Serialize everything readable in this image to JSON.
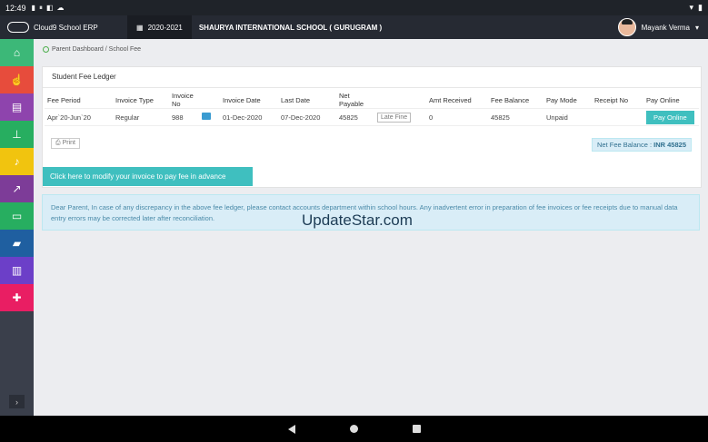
{
  "status_bar": {
    "time": "12:49",
    "left_icons": [
      "notification-icon",
      "pause-icon",
      "flipboard-icon",
      "cloud-icon"
    ],
    "right_icons": [
      "wifi-icon",
      "battery-icon"
    ]
  },
  "header": {
    "app_name": "Cloud9 School ERP",
    "academic_year": "2020-2021",
    "school_name": "SHAURYA INTERNATIONAL SCHOOL ( GURUGRAM )",
    "user_name": "Mayank Verma"
  },
  "sidebar": {
    "items": [
      {
        "icon": "home-icon",
        "color": "#3cb878"
      },
      {
        "icon": "hand-pointer-icon",
        "color": "#e74c3c"
      },
      {
        "icon": "file-icon",
        "color": "#8e44ad"
      },
      {
        "icon": "pin-icon",
        "color": "#27ae60"
      },
      {
        "icon": "bell-icon",
        "color": "#f1c40f"
      },
      {
        "icon": "chart-line-icon",
        "color": "#7d3c98"
      },
      {
        "icon": "credit-card-icon",
        "color": "#27ae60"
      },
      {
        "icon": "book-icon",
        "color": "#1f5fa0"
      },
      {
        "icon": "building-icon",
        "color": "#6c3fc8"
      },
      {
        "icon": "plus-icon",
        "color": "#e91e63"
      }
    ],
    "toggle": "›"
  },
  "breadcrumb": "Parent Dashboard / School Fee",
  "ledger": {
    "title": "Student Fee Ledger",
    "columns": [
      "Fee Period",
      "Invoice Type",
      "Invoice No",
      "",
      "Invoice Date",
      "Last Date",
      "Net Payable",
      "",
      "Amt Received",
      "Fee Balance",
      "Pay Mode",
      "Receipt No",
      "Pay Online"
    ],
    "rows": [
      {
        "fee_period": "Apr`20-Jun`20",
        "invoice_type": "Regular",
        "invoice_no": "988",
        "invoice_date": "01-Dec-2020",
        "last_date": "07-Dec-2020",
        "net_payable": "45825",
        "late_fine": "Late Fine",
        "amt_received": "0",
        "fee_balance": "45825",
        "pay_mode": "Unpaid",
        "receipt_no": "",
        "pay_online": "Pay Online"
      }
    ],
    "print_label": "Print",
    "net_balance_label": "Net Fee Balance :",
    "net_balance_value": "INR 45825"
  },
  "modify_button": "Click here to modify your invoice to pay fee in advance",
  "notice": "Dear Parent, In case of any discrepancy in the above fee ledger, please contact accounts department within school hours. Any inadvertent error in preparation of fee invoices or fee receipts due to manual data entry errors may be corrected later after reconciliation.",
  "watermark": "UpdateStar.com"
}
